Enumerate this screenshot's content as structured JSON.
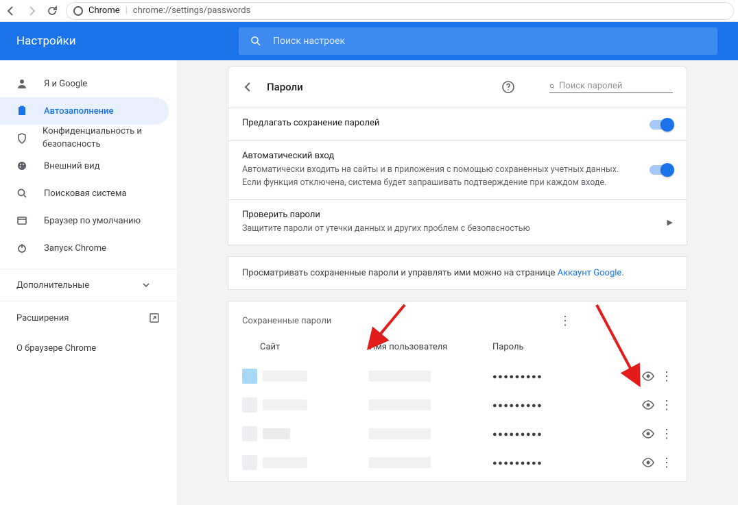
{
  "browser": {
    "label_chrome": "Chrome",
    "url": "chrome://settings/passwords"
  },
  "header": {
    "title": "Настройки",
    "search_placeholder": "Поиск настроек"
  },
  "sidebar": {
    "items": [
      {
        "label": "Я и Google"
      },
      {
        "label": "Автозаполнение"
      },
      {
        "label": "Конфиденциальность и безопасность"
      },
      {
        "label": "Внешний вид"
      },
      {
        "label": "Поисковая система"
      },
      {
        "label": "Браузер по умолчанию"
      },
      {
        "label": "Запуск Chrome"
      }
    ],
    "advanced": "Дополнительные",
    "extensions": "Расширения",
    "about": "О браузере Chrome"
  },
  "page": {
    "title": "Пароли",
    "search_placeholder": "Поиск паролей",
    "offer_save": "Предлагать сохранение паролей",
    "autosignin_title": "Автоматический вход",
    "autosignin_desc": "Автоматически входить на сайты и в приложения с помощью сохраненных учетных данных. Если функция отключена, система будет запрашивать подтверждение при каждом входе.",
    "check_title": "Проверить пароли",
    "check_desc": "Защитите пароли от утечки данных и других проблем с безопасностью",
    "manage_prefix": "Просматривать сохраненные пароли и управлять ими можно на странице ",
    "manage_link": "Аккаунт Google",
    "saved_title": "Сохраненные пароли",
    "col_site": "Сайт",
    "col_user": "Имя пользователя",
    "col_pass": "Пароль",
    "mask": "●●●●●●●●●",
    "rows": [
      {},
      {},
      {},
      {}
    ]
  }
}
